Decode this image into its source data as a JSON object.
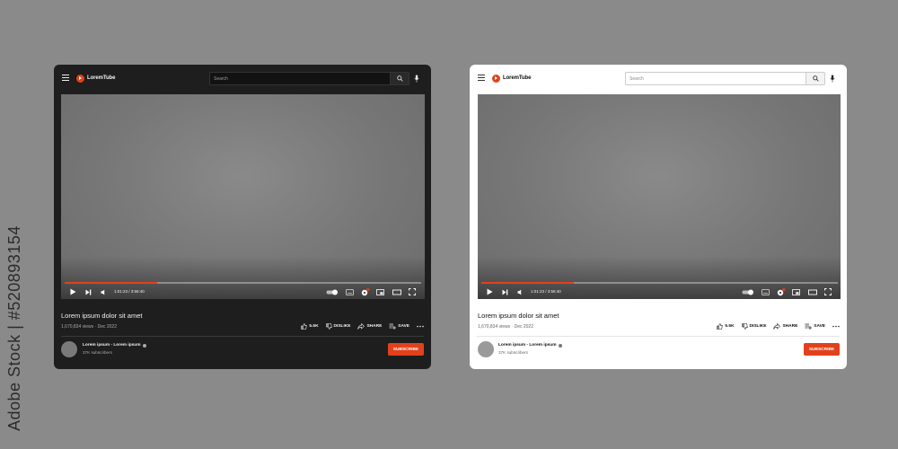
{
  "watermark": "Adobe Stock | #520893154",
  "brand": {
    "name": "LoremTube",
    "accent": "#e2411c"
  },
  "search": {
    "placeholder": "Search"
  },
  "video": {
    "time_current": "1:01:23",
    "time_total": "3:56:40",
    "time_display": "1:01:23 / 3:56:40",
    "progress_fraction": 0.26
  },
  "info": {
    "title": "Lorem ipsum dolor sit amet",
    "meta": "1,670,834 views · Dec 2022",
    "like_count": "5.5K",
    "dislike_label": "DISLIKE",
    "share_label": "SHARE",
    "save_label": "SAVE"
  },
  "channel": {
    "name": "Lorem ipsum - Lorem ipsum",
    "subscribers": "37K subscribers",
    "subscribe_label": "SUBSCRIBE"
  },
  "themes": {
    "dark_bg": "#1e1e1e",
    "light_bg": "#ffffff"
  },
  "icons": [
    "menu-icon",
    "logo-icon",
    "search-icon",
    "mic-icon",
    "play-icon",
    "next-icon",
    "volume-icon",
    "autoplay-toggle",
    "subtitles-icon",
    "settings-icon",
    "miniplayer-icon",
    "theater-icon",
    "fullscreen-icon",
    "like-icon",
    "dislike-icon",
    "share-icon",
    "save-icon",
    "more-icon",
    "verified-icon"
  ]
}
